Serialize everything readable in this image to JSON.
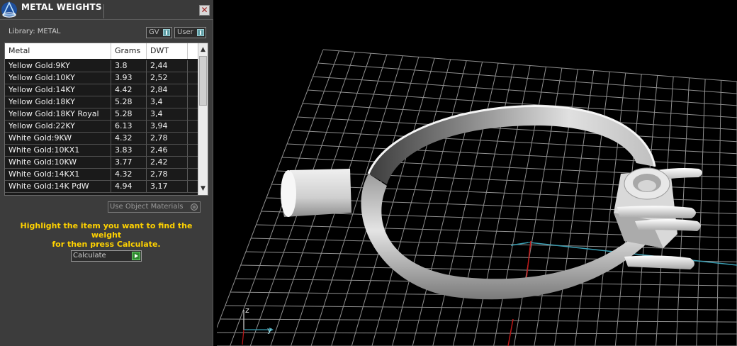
{
  "panel": {
    "title": "METAL WEIGHTS",
    "close_label": "✕",
    "library_label": "Library: METAL",
    "toggle_gv_label": "GV",
    "toggle_user_label": "User",
    "use_object_materials_label": "Use Object Materials",
    "hint_line1": "Highlight the item you want to find the weight",
    "hint_line2": "for then press Calculate.",
    "calculate_label": "Calculate"
  },
  "table": {
    "columns": [
      "Metal",
      "Grams",
      "DWT"
    ],
    "rows": [
      {
        "metal": "Yellow Gold:9KY",
        "grams": "3.8",
        "dwt": "2,44"
      },
      {
        "metal": "Yellow Gold:10KY",
        "grams": "3.93",
        "dwt": "2,52"
      },
      {
        "metal": "Yellow Gold:14KY",
        "grams": "4.42",
        "dwt": "2,84"
      },
      {
        "metal": "Yellow Gold:18KY",
        "grams": "5.28",
        "dwt": "3,4"
      },
      {
        "metal": "Yellow Gold:18KY Royal",
        "grams": "5.28",
        "dwt": "3,4"
      },
      {
        "metal": "Yellow Gold:22KY",
        "grams": "6.13",
        "dwt": "3,94"
      },
      {
        "metal": "White Gold:9KW",
        "grams": "4.32",
        "dwt": "2,78"
      },
      {
        "metal": "White Gold:10KX1",
        "grams": "3.83",
        "dwt": "2,46"
      },
      {
        "metal": "White Gold:10KW",
        "grams": "3.77",
        "dwt": "2,42"
      },
      {
        "metal": "White Gold:14KX1",
        "grams": "4.32",
        "dwt": "2,78"
      },
      {
        "metal": "White Gold:14K PdW",
        "grams": "4.94",
        "dwt": "3,17"
      }
    ]
  },
  "viewport": {
    "axis_z": "z",
    "axis_y": "y"
  },
  "colors": {
    "panel_bg": "#3c3c3c",
    "hint_text": "#ffd200",
    "viewport_bg": "#000000",
    "grid": "#9a9a9a",
    "axis_x": "#c01818",
    "axis_y": "#3aa0b5"
  },
  "icons": {
    "logo": "app-logo-icon",
    "close": "close-icon",
    "calculate": "play-icon",
    "scroll_up": "chevron-up-icon",
    "scroll_down": "chevron-down-icon"
  }
}
